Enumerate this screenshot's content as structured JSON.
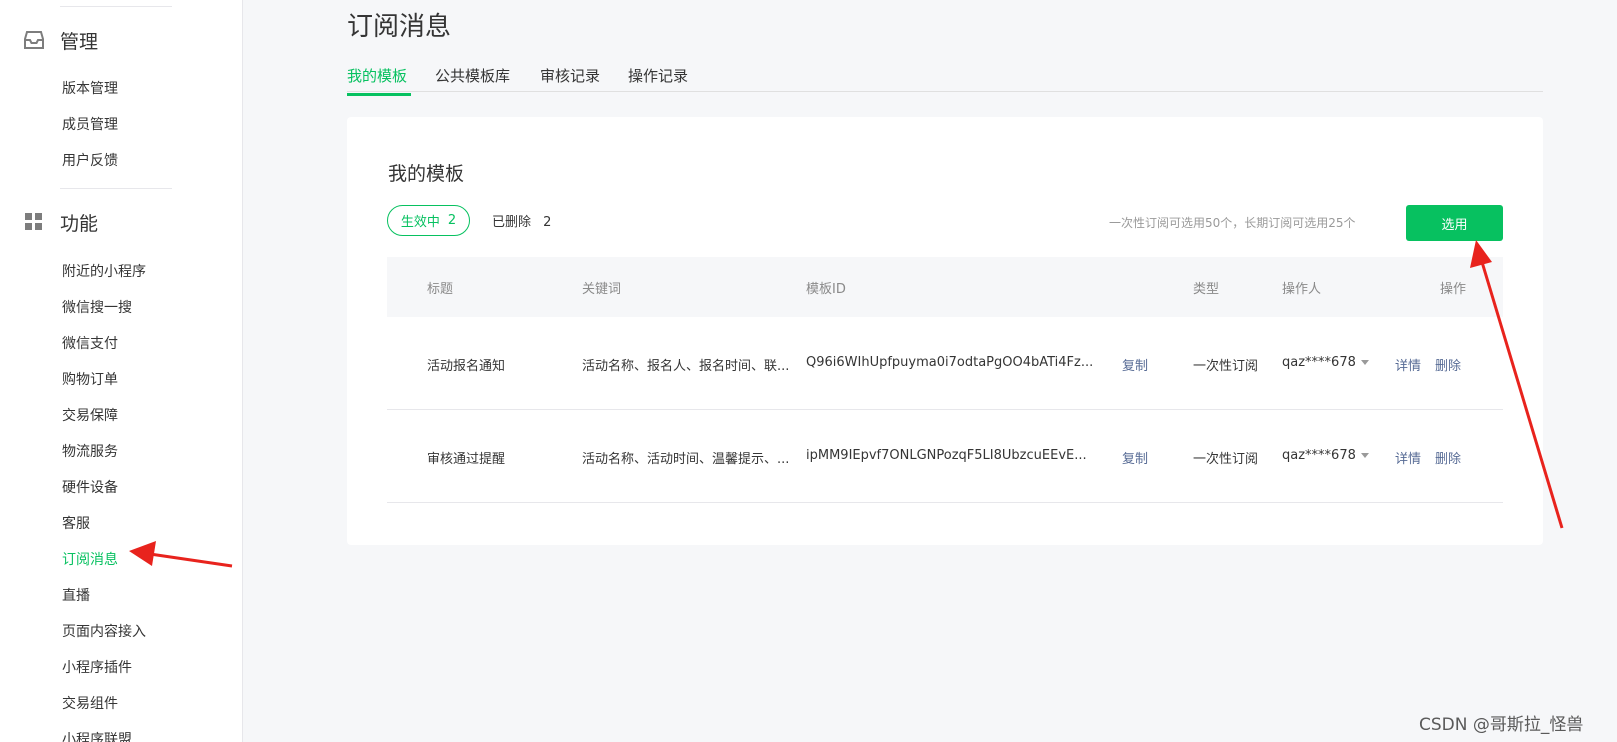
{
  "sidebar": {
    "manage_section": {
      "label": "管理",
      "icon": "inbox-icon"
    },
    "manage_items": [
      "版本管理",
      "成员管理",
      "用户反馈"
    ],
    "feature_section": {
      "label": "功能",
      "icon": "grid-icon"
    },
    "feature_items": [
      "附近的小程序",
      "微信搜一搜",
      "微信支付",
      "购物订单",
      "交易保障",
      "物流服务",
      "硬件设备",
      "客服",
      "订阅消息",
      "直播",
      "页面内容接入",
      "小程序插件",
      "交易组件",
      "小程序联盟"
    ],
    "active_item": "订阅消息"
  },
  "main": {
    "title": "订阅消息",
    "tabs": [
      "我的模板",
      "公共模板库",
      "审核记录",
      "操作记录"
    ],
    "active_tab": "我的模板",
    "card": {
      "title": "我的模板",
      "filter_active": "生效中",
      "filter_active_count": "2",
      "filter_deleted": "已删除",
      "filter_deleted_count": "2",
      "limit_note": "一次性订阅可选用50个，长期订阅可选用25个",
      "select_button": "选用"
    },
    "table": {
      "columns": [
        "标题",
        "关键词",
        "模板ID",
        "类型",
        "操作人",
        "操作"
      ],
      "rows": [
        {
          "title": "活动报名通知",
          "keywords": "活动名称、报名人、报名时间、联...",
          "template_id": "Q96i6WIhUpfpuyma0i7odtaPgOO4bATi4Fz...",
          "copy": "复制",
          "type": "一次性订阅",
          "operator": "qaz****678",
          "detail": "详情",
          "delete": "删除"
        },
        {
          "title": "审核通过提醒",
          "keywords": "活动名称、活动时间、温馨提示、...",
          "template_id": "ipMM9IEpvf7ONLGNPozqF5LI8UbzcuEEvE...",
          "copy": "复制",
          "type": "一次性订阅",
          "operator": "qaz****678",
          "detail": "详情",
          "delete": "删除"
        }
      ]
    }
  },
  "watermark": "CSDN @哥斯拉_怪兽",
  "colors": {
    "accent": "#07c160",
    "link": "#576b95",
    "annotation_arrow": "#e8231d"
  }
}
